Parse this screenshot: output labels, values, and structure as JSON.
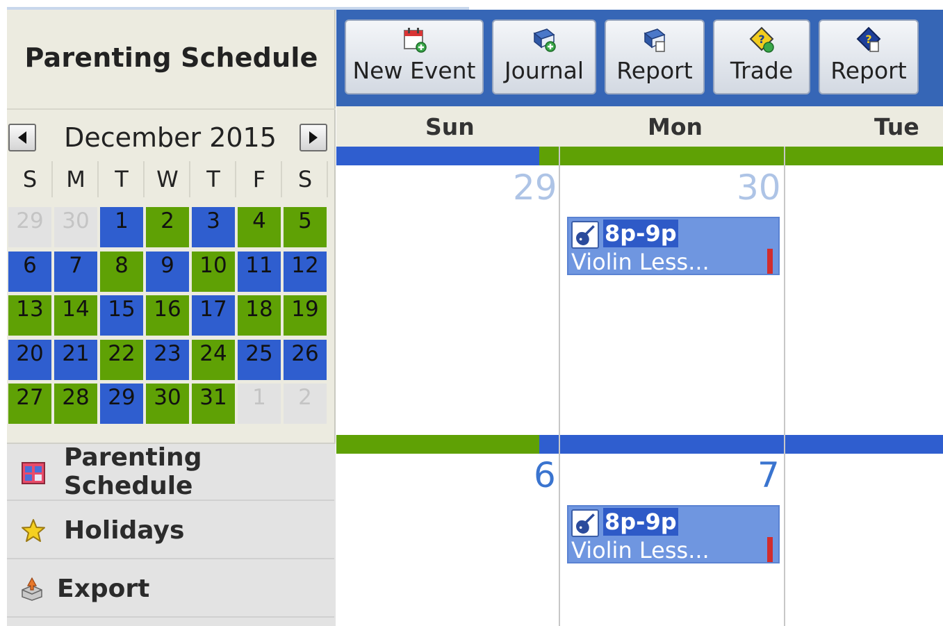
{
  "sidebar": {
    "title": "Parenting Schedule",
    "calendar": {
      "month_label": "December 2015",
      "weekdays": [
        "S",
        "M",
        "T",
        "W",
        "T",
        "F",
        "S"
      ],
      "weeks": [
        [
          {
            "d": "29",
            "c": "other"
          },
          {
            "d": "30",
            "c": "other"
          },
          {
            "d": "1",
            "c": "blue"
          },
          {
            "d": "2",
            "c": "green"
          },
          {
            "d": "3",
            "c": "blue"
          },
          {
            "d": "4",
            "c": "green"
          },
          {
            "d": "5",
            "c": "green"
          }
        ],
        [
          {
            "d": "6",
            "c": "blue"
          },
          {
            "d": "7",
            "c": "blue"
          },
          {
            "d": "8",
            "c": "green"
          },
          {
            "d": "9",
            "c": "blue"
          },
          {
            "d": "10",
            "c": "green"
          },
          {
            "d": "11",
            "c": "blue"
          },
          {
            "d": "12",
            "c": "blue"
          }
        ],
        [
          {
            "d": "13",
            "c": "green"
          },
          {
            "d": "14",
            "c": "green"
          },
          {
            "d": "15",
            "c": "blue"
          },
          {
            "d": "16",
            "c": "green"
          },
          {
            "d": "17",
            "c": "blue"
          },
          {
            "d": "18",
            "c": "green"
          },
          {
            "d": "19",
            "c": "green"
          }
        ],
        [
          {
            "d": "20",
            "c": "blue"
          },
          {
            "d": "21",
            "c": "blue"
          },
          {
            "d": "22",
            "c": "green"
          },
          {
            "d": "23",
            "c": "blue"
          },
          {
            "d": "24",
            "c": "green"
          },
          {
            "d": "25",
            "c": "blue"
          },
          {
            "d": "26",
            "c": "blue"
          }
        ],
        [
          {
            "d": "27",
            "c": "green"
          },
          {
            "d": "28",
            "c": "green"
          },
          {
            "d": "29",
            "c": "blue"
          },
          {
            "d": "30",
            "c": "green"
          },
          {
            "d": "31",
            "c": "green"
          },
          {
            "d": "1",
            "c": "other"
          },
          {
            "d": "2",
            "c": "other"
          }
        ]
      ]
    },
    "menu": [
      {
        "label": "Parenting Schedule",
        "icon": "calendar-grid-icon"
      },
      {
        "label": "Holidays",
        "icon": "star-icon"
      },
      {
        "label": "Export",
        "icon": "export-icon"
      }
    ]
  },
  "toolbar": {
    "buttons": [
      {
        "label": "New Event",
        "icon": "new-event-icon"
      },
      {
        "label": "Journal",
        "icon": "journal-icon"
      },
      {
        "label": "Report",
        "icon": "report-icon"
      },
      {
        "label": "Trade",
        "icon": "trade-icon"
      },
      {
        "label": "Report",
        "icon": "report-alert-icon"
      }
    ]
  },
  "week_view": {
    "day_names": [
      "Sun",
      "Mon",
      "Tue"
    ],
    "rows": [
      {
        "dates": [
          "29",
          "30"
        ],
        "date_style": "faded"
      },
      {
        "dates": [
          "6",
          "7"
        ],
        "date_style": "current"
      }
    ],
    "events": [
      {
        "time": "8p-9p",
        "title": "Violin Less...",
        "icon": "violin-icon"
      },
      {
        "time": "8p-9p",
        "title": "Violin Less...",
        "icon": "violin-icon"
      }
    ]
  },
  "colors": {
    "blue_custody": "#2f5ecf",
    "green_custody": "#5fa105",
    "toolbar_bg": "#3666b6",
    "event_bg": "#6f96e0",
    "event_flag": "#d22d2d"
  }
}
